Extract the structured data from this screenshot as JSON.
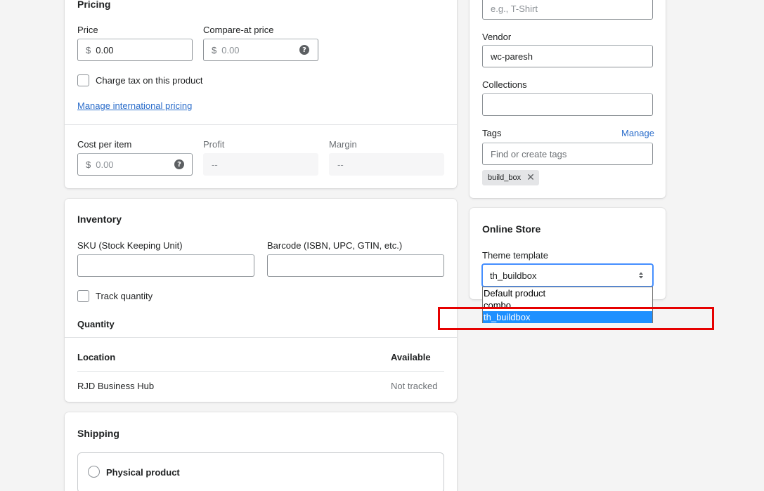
{
  "pricing": {
    "title": "Pricing",
    "price_label": "Price",
    "price_prefix": "$",
    "price_value": "0.00",
    "compare_label": "Compare-at price",
    "compare_prefix": "$",
    "compare_placeholder": "0.00",
    "charge_tax_label": "Charge tax on this product",
    "international_link": "Manage international pricing",
    "cost_label": "Cost per item",
    "cost_prefix": "$",
    "cost_placeholder": "0.00",
    "profit_label": "Profit",
    "profit_value": "--",
    "margin_label": "Margin",
    "margin_value": "--",
    "help_glyph": "?"
  },
  "inventory": {
    "title": "Inventory",
    "sku_label": "SKU (Stock Keeping Unit)",
    "barcode_label": "Barcode (ISBN, UPC, GTIN, etc.)",
    "track_label": "Track quantity",
    "quantity_title": "Quantity",
    "location_header": "Location",
    "available_header": "Available",
    "rows": [
      {
        "location": "RJD Business Hub",
        "available": "Not tracked"
      }
    ]
  },
  "shipping": {
    "title": "Shipping",
    "physical_label": "Physical product"
  },
  "organization": {
    "type_placeholder": "e.g., T-Shirt",
    "vendor_label": "Vendor",
    "vendor_value": "wc-paresh",
    "collections_label": "Collections",
    "tags_label": "Tags",
    "tags_manage": "Manage",
    "tags_placeholder": "Find or create tags",
    "tags": [
      "build_box"
    ],
    "tag_remove_glyph": "✕"
  },
  "online_store": {
    "title": "Online Store",
    "theme_label": "Theme template",
    "selected": "th_buildbox",
    "options": [
      "Default product",
      "combo",
      "th_buildbox"
    ]
  },
  "colors": {
    "link": "#2c6ecb",
    "focus": "#458fff",
    "highlight": "#1e90ff",
    "annotation": "#e60000"
  }
}
